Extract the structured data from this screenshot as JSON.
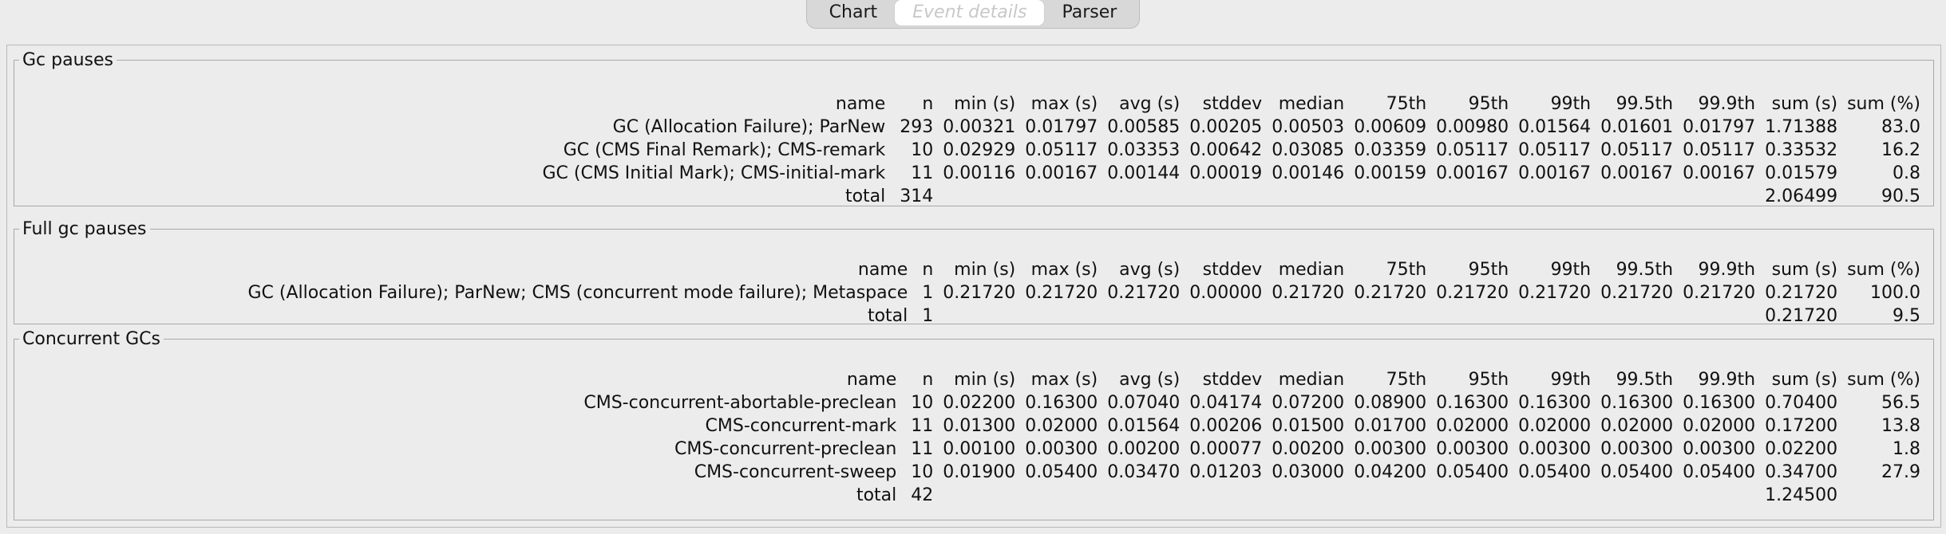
{
  "tabs": [
    {
      "label": "Chart",
      "selected": false
    },
    {
      "label": "Event details",
      "selected": true
    },
    {
      "label": "Parser",
      "selected": false
    }
  ],
  "columns": [
    "name",
    "n",
    "min (s)",
    "max (s)",
    "avg (s)",
    "stddev",
    "median",
    "75th",
    "95th",
    "99th",
    "99.5th",
    "99.9th",
    "sum (s)",
    "sum (%)"
  ],
  "groups": [
    {
      "title": "Gc pauses",
      "rows": [
        [
          "GC (Allocation Failure); ParNew",
          "293",
          "0.00321",
          "0.01797",
          "0.00585",
          "0.00205",
          "0.00503",
          "0.00609",
          "0.00980",
          "0.01564",
          "0.01601",
          "0.01797",
          "1.71388",
          "83.0"
        ],
        [
          "GC (CMS Final Remark); CMS-remark",
          "10",
          "0.02929",
          "0.05117",
          "0.03353",
          "0.00642",
          "0.03085",
          "0.03359",
          "0.05117",
          "0.05117",
          "0.05117",
          "0.05117",
          "0.33532",
          "16.2"
        ],
        [
          "GC (CMS Initial Mark); CMS-initial-mark",
          "11",
          "0.00116",
          "0.00167",
          "0.00144",
          "0.00019",
          "0.00146",
          "0.00159",
          "0.00167",
          "0.00167",
          "0.00167",
          "0.00167",
          "0.01579",
          "0.8"
        ]
      ],
      "total": {
        "label": "total",
        "n": "314",
        "sum_s": "2.06499",
        "sum_pct": "90.5"
      }
    },
    {
      "title": "Full gc pauses",
      "rows": [
        [
          "GC (Allocation Failure); ParNew; CMS (concurrent mode failure); Metaspace",
          "1",
          "0.21720",
          "0.21720",
          "0.21720",
          "0.00000",
          "0.21720",
          "0.21720",
          "0.21720",
          "0.21720",
          "0.21720",
          "0.21720",
          "0.21720",
          "100.0"
        ]
      ],
      "total": {
        "label": "total",
        "n": "1",
        "sum_s": "0.21720",
        "sum_pct": "9.5"
      }
    },
    {
      "title": "Concurrent GCs",
      "rows": [
        [
          "CMS-concurrent-abortable-preclean",
          "10",
          "0.02200",
          "0.16300",
          "0.07040",
          "0.04174",
          "0.07200",
          "0.08900",
          "0.16300",
          "0.16300",
          "0.16300",
          "0.16300",
          "0.70400",
          "56.5"
        ],
        [
          "CMS-concurrent-mark",
          "11",
          "0.01300",
          "0.02000",
          "0.01564",
          "0.00206",
          "0.01500",
          "0.01700",
          "0.02000",
          "0.02000",
          "0.02000",
          "0.02000",
          "0.17200",
          "13.8"
        ],
        [
          "CMS-concurrent-preclean",
          "11",
          "0.00100",
          "0.00300",
          "0.00200",
          "0.00077",
          "0.00200",
          "0.00300",
          "0.00300",
          "0.00300",
          "0.00300",
          "0.00300",
          "0.02200",
          "1.8"
        ],
        [
          "CMS-concurrent-sweep",
          "10",
          "0.01900",
          "0.05400",
          "0.03470",
          "0.01203",
          "0.03000",
          "0.04200",
          "0.05400",
          "0.05400",
          "0.05400",
          "0.05400",
          "0.34700",
          "27.9"
        ]
      ],
      "total": {
        "label": "total",
        "n": "42",
        "sum_s": "1.24500",
        "sum_pct": ""
      }
    }
  ]
}
